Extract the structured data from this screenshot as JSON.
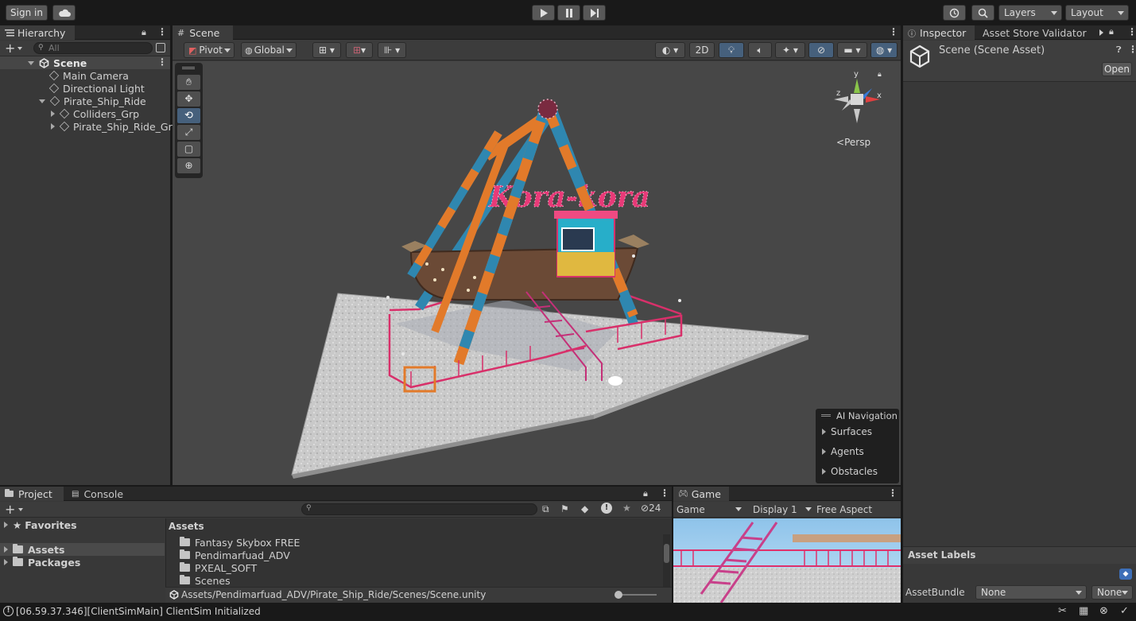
{
  "toolbar": {
    "sign_in": "Sign in",
    "layers": "Layers",
    "layout": "Layout"
  },
  "hierarchy": {
    "tab": "Hierarchy",
    "search_placeholder": "All",
    "scene": "Scene",
    "items": [
      {
        "label": "Main Camera"
      },
      {
        "label": "Directional Light"
      },
      {
        "label": "Pirate_Ship_Ride"
      },
      {
        "label": "Colliders_Grp"
      },
      {
        "label": "Pirate_Ship_Ride_Grp"
      }
    ]
  },
  "scene_view": {
    "tab": "Scene",
    "pivot": "Pivot",
    "global": "Global",
    "mode_2d": "2D",
    "persp": "Persp",
    "gizmo_axes": {
      "y": "y",
      "x": "x",
      "z": "z"
    },
    "sign_text": "Kora-kora",
    "ai_nav": {
      "title": "AI Navigation",
      "items": [
        "Surfaces",
        "Agents",
        "Obstacles"
      ]
    }
  },
  "inspector": {
    "tab": "Inspector",
    "tab2": "Asset Store Validator",
    "title": "Scene (Scene Asset)",
    "open": "Open",
    "asset_labels": "Asset Labels",
    "assetbundle_label": "AssetBundle",
    "assetbundle_value": "None",
    "variant_value": "None"
  },
  "project": {
    "tab": "Project",
    "console_tab": "Console",
    "favorites": "Favorites",
    "assets": "Assets",
    "packages": "Packages",
    "assets_header": "Assets",
    "folders": [
      "Fantasy Skybox FREE",
      "Pendimarfuad_ADV",
      "PXEAL_SOFT",
      "Scenes"
    ],
    "hidden_count": "24",
    "path": "Assets/Pendimarfuad_ADV/Pirate_Ship_Ride/Scenes/Scene.unity"
  },
  "game": {
    "tab": "Game",
    "mode": "Game",
    "display": "Display 1",
    "aspect": "Free Aspect"
  },
  "status": {
    "message": "[06.59.37.346][ClientSimMain] ClientSim Initialized"
  },
  "colors": {
    "bg": "#191919",
    "panel": "#383838",
    "scene_bg": "#474747",
    "accent": "#46607c",
    "rail_pink": "#d8306a",
    "frame_orange": "#e27a2a",
    "frame_blue": "#2f87b0"
  }
}
